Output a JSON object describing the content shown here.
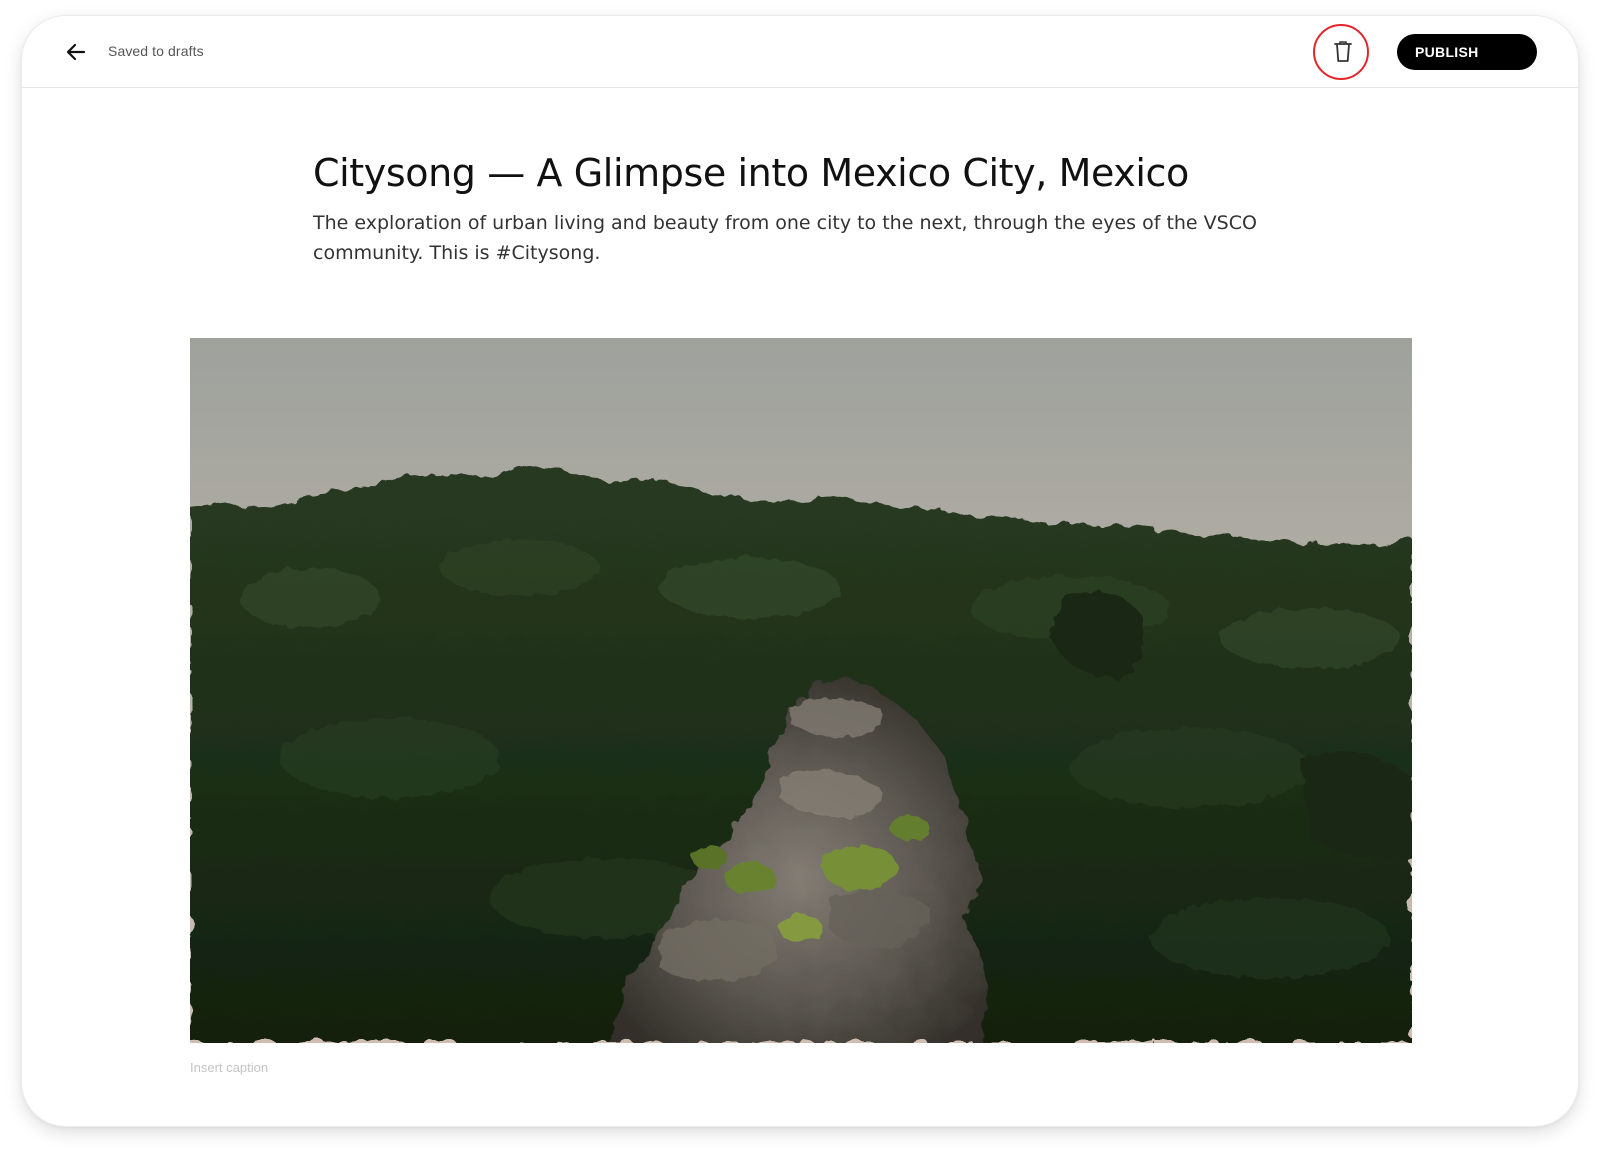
{
  "header": {
    "back_icon": "arrow-left-icon",
    "status_text": "Saved to drafts",
    "delete_icon": "trash-icon",
    "publish_label": "PUBLISH",
    "highlight_color": "#e3262b"
  },
  "article": {
    "title": "Citysong — A Glimpse into Mexico City, Mexico",
    "subtitle": "The exploration of urban living and beauty from one city to the next, through the eyes of the VSCO community. This is #Citysong."
  },
  "image": {
    "subject": "forested hillside with rocky outcrop at dusk",
    "caption_placeholder": "Insert caption"
  },
  "colors": {
    "accent": "#000000",
    "button_text": "#ffffff"
  }
}
